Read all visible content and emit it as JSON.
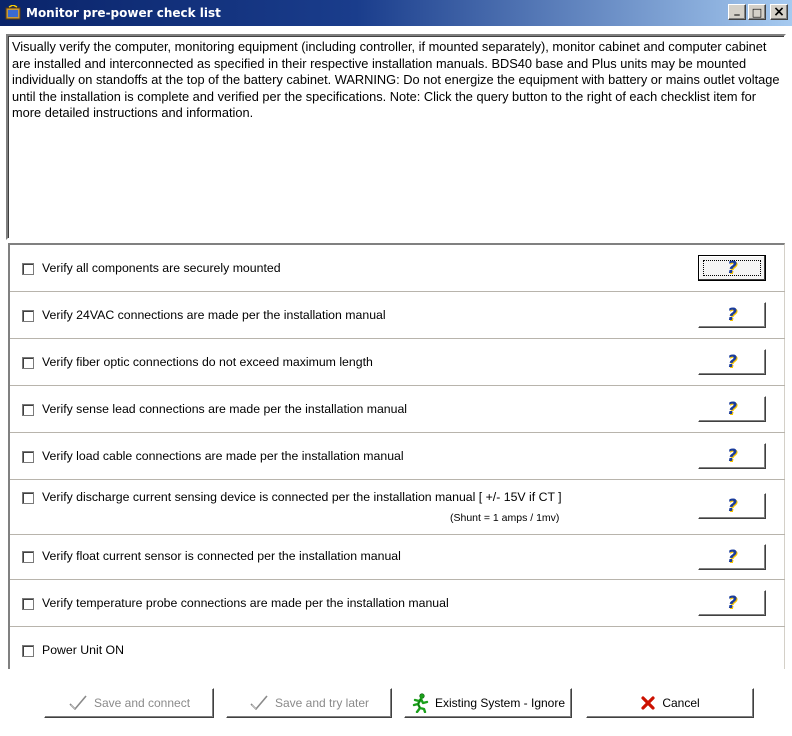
{
  "window": {
    "title": "Monitor pre-power check list",
    "controls": {
      "minimize": "_",
      "maximize": "□",
      "close": "×"
    }
  },
  "description": "Visually verify the computer, monitoring equipment (including controller, if mounted separately), monitor cabinet and computer cabinet are installed and interconnected as specified in their respective installation manuals. BDS40 base and Plus units may be mounted individually on standoffs at the top of the battery cabinet. WARNING: Do not energize the equipment with battery or mains outlet voltage until the installation is complete and verified per the specifications. Note: Click the query button to the right of each checklist item for more detailed instructions and information.",
  "checklist": [
    {
      "label": "Verify all components are securely mounted",
      "checked": false,
      "help": "?"
    },
    {
      "label": "Verify 24VAC connections are made per the installation manual",
      "checked": false,
      "help": "?"
    },
    {
      "label": "Verify fiber optic connections do not exceed maximum length",
      "checked": false,
      "help": "?"
    },
    {
      "label": "Verify sense lead connections are made per the installation manual",
      "checked": false,
      "help": "?"
    },
    {
      "label": "Verify load cable connections are made per the installation manual",
      "checked": false,
      "help": "?"
    },
    {
      "label": "Verify discharge current sensing device is connected per the installation manual [ +/- 15V if CT ]",
      "sublabel": "(Shunt = 1 amps / 1mv)",
      "checked": false,
      "help": "?"
    },
    {
      "label": "Verify float current sensor is connected per the installation manual",
      "checked": false,
      "help": "?"
    },
    {
      "label": "Verify temperature probe connections are made per the installation manual",
      "checked": false,
      "help": "?"
    },
    {
      "label": "Power Unit ON",
      "checked": false
    }
  ],
  "buttons": {
    "save_connect": "Save and connect",
    "save_later": "Save and try later",
    "existing_ignore": "Existing System - Ignore",
    "cancel": "Cancel"
  },
  "colors": {
    "title_gradient_start": "#0a246a",
    "title_gradient_end": "#a6caf0",
    "help_icon": "#1a3c9c",
    "cancel_icon": "#cc1100",
    "ignore_icon": "#1aa01a",
    "disabled_text": "#8a8a8a"
  },
  "icons": {
    "app": "app-icon",
    "save_connect": "checkmark-icon",
    "save_later": "checkmark-icon",
    "existing_ignore": "running-man-icon",
    "cancel": "red-x-icon"
  }
}
